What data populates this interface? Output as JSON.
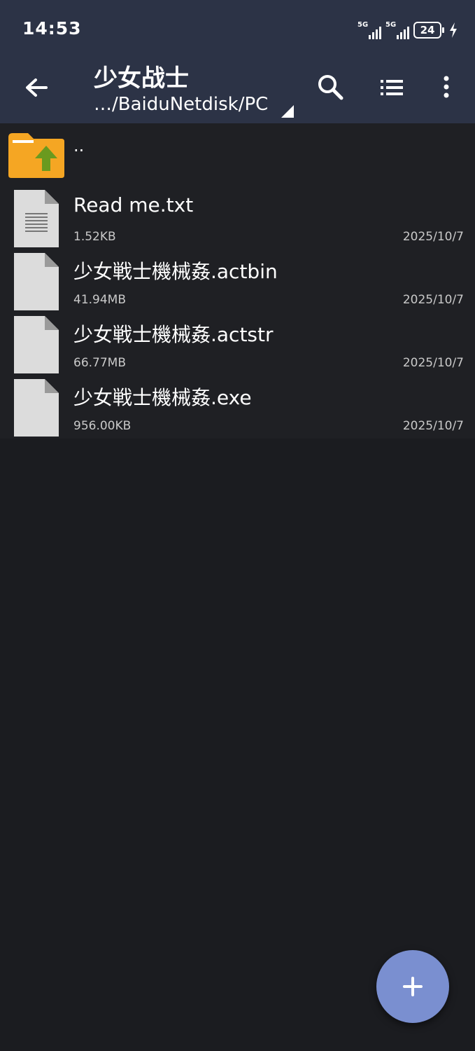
{
  "status_bar": {
    "time": "14:53",
    "network1": "5G",
    "network2": "5G",
    "battery": "24"
  },
  "toolbar": {
    "title": "少女战士",
    "path": "…/BaiduNetdisk/PC",
    "icons": [
      "back-arrow-icon",
      "search-icon",
      "list-view-icon",
      "more-vert-icon"
    ]
  },
  "listing": {
    "parent_label": "..",
    "files": [
      {
        "name": "Read me.txt",
        "size": "1.52KB",
        "date": "2025/10/7",
        "icon": "text-file-icon"
      },
      {
        "name": "少女戦士機械姦.actbin",
        "size": "41.94MB",
        "date": "2025/10/7",
        "icon": "file-icon"
      },
      {
        "name": "少女戦士機械姦.actstr",
        "size": "66.77MB",
        "date": "2025/10/7",
        "icon": "file-icon"
      },
      {
        "name": "少女戦士機械姦.exe",
        "size": "956.00KB",
        "date": "2025/10/7",
        "icon": "file-icon"
      }
    ]
  },
  "colors": {
    "toolbar_bg": "#2c3346",
    "page_bg": "#1b1c20",
    "fab": "#7a8fd0",
    "folder": "#f5a623",
    "folder_arrow": "#6a9a1f"
  }
}
